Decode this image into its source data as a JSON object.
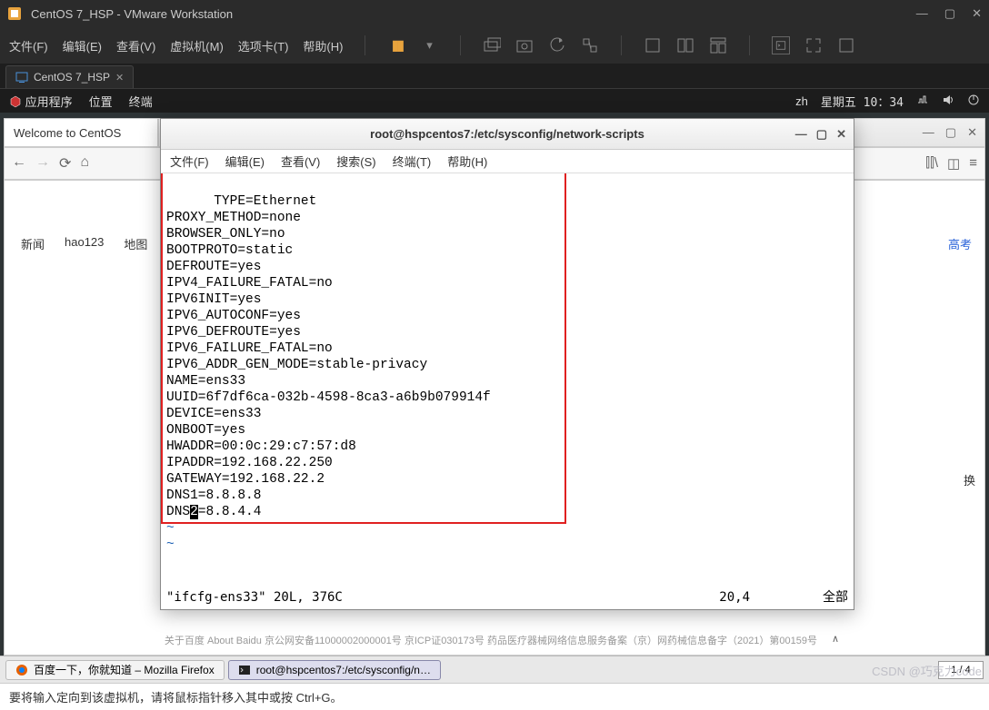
{
  "vmware": {
    "title": "CentOS 7_HSP - VMware Workstation",
    "menu": [
      "文件(F)",
      "编辑(E)",
      "查看(V)",
      "虚拟机(M)",
      "选项卡(T)",
      "帮助(H)"
    ],
    "tab": "CentOS 7_HSP",
    "status": "要将输入定向到该虚拟机，请将鼠标指针移入其中或按 Ctrl+G。"
  },
  "gnome": {
    "apps": [
      "应用程序",
      "位置",
      "终端"
    ],
    "tray_lang": "zh",
    "tray_time": "星期五 10：34",
    "taskbar": {
      "firefox": "百度一下，你就知道 – Mozilla Firefox",
      "terminal": "root@hspcentos7:/etc/sysconfig/n…"
    },
    "workspace": "1 / 4"
  },
  "welcome": "Welcome to CentOS",
  "firefox": {
    "title": "百度一下，你就知道 — Mozilla Firefox",
    "links": [
      "新闻",
      "hao123",
      "地图"
    ],
    "rightlink": "高考",
    "huan": "换",
    "footer": "关于百度   About Baidu   京公网安备11000002000001号   京ICP证030173号   药品医疗器械网络信息服务备案（京）网药械信息备字（2021）第00159号"
  },
  "terminal": {
    "title": "root@hspcentos7:/etc/sysconfig/network-scripts",
    "menu": [
      "文件(F)",
      "编辑(E)",
      "查看(V)",
      "搜索(S)",
      "终端(T)",
      "帮助(H)"
    ],
    "content": [
      "TYPE=Ethernet",
      "PROXY_METHOD=none",
      "BROWSER_ONLY=no",
      "BOOTPROTO=static",
      "DEFROUTE=yes",
      "IPV4_FAILURE_FATAL=no",
      "IPV6INIT=yes",
      "IPV6_AUTOCONF=yes",
      "IPV6_DEFROUTE=yes",
      "IPV6_FAILURE_FATAL=no",
      "IPV6_ADDR_GEN_MODE=stable-privacy",
      "NAME=ens33",
      "UUID=6f7df6ca-032b-4598-8ca3-a6b9b079914f",
      "DEVICE=ens33",
      "ONBOOT=yes",
      "HWADDR=00:0c:29:c7:57:d8",
      "IPADDR=192.168.22.250",
      "GATEWAY=192.168.22.2",
      "DNS1=8.8.8.8",
      "DNS2=8.8.4.4"
    ],
    "status_left": "\"ifcfg-ens33\" 20L, 376C",
    "status_pos": "20,4",
    "status_right": "全部"
  },
  "watermark": "CSDN @巧克力code"
}
